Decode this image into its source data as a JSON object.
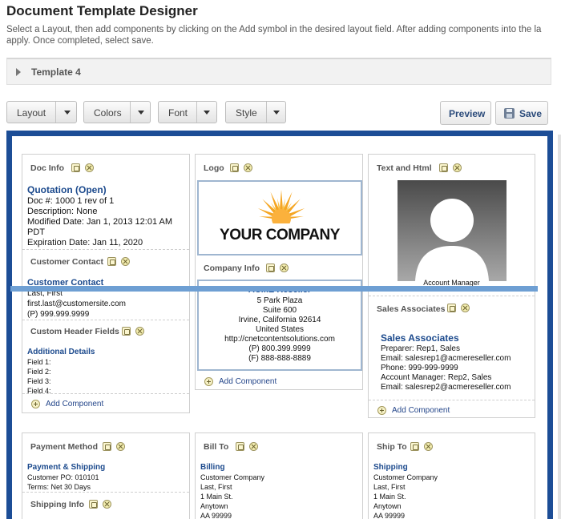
{
  "page": {
    "title": "Document Template Designer",
    "instructions": "Select a Layout, then add components by clicking on the Add symbol in the desired layout field. After adding components into the la apply. Once completed, select save."
  },
  "template": {
    "label": "Template 4",
    "icon": "triangle-right-icon"
  },
  "toolbar": {
    "layout": "Layout",
    "colors": "Colors",
    "font": "Font",
    "style": "Style",
    "preview": "Preview",
    "save": "Save"
  },
  "common": {
    "add_component": "Add Component"
  },
  "doc_info": {
    "header": "Doc Info",
    "title": "Quotation (Open)",
    "lines": [
      "Doc #: 1000   1 rev of 1",
      "Description: None",
      "Modified Date: Jan 1, 2013 12:01 AM",
      "PDT",
      "Expiration Date: Jan 11, 2020"
    ]
  },
  "customer_contact": {
    "header": "Customer Contact",
    "title": "Customer Contact",
    "lines": [
      "Last, First",
      "first.last@customersite.com",
      "(P) 999.999.9999"
    ]
  },
  "custom_header": {
    "header": "Custom Header Fields",
    "title": "Additional Details",
    "lines": [
      "Field 1:",
      "Field 2:",
      "Field 3:",
      "Field 4:"
    ]
  },
  "logo": {
    "header": "Logo",
    "text": "YOUR COMPANY",
    "sun_color": "#f5a623"
  },
  "company_info": {
    "header": "Company Info",
    "title": "ACME Reseller",
    "lines": [
      "5 Park Plaza",
      "Suite 600",
      "Irvine, California 92614",
      "United States",
      "http://cnetcontentsolutions.com",
      "(P) 800.399.9999",
      "(F) 888-888-8889"
    ]
  },
  "text_html": {
    "header": "Text and Html",
    "caption": "Account Manager"
  },
  "sales_associates": {
    "header": "Sales Associates",
    "title": "Sales Associates",
    "lines": [
      "Preparer: Rep1, Sales",
      "Email: salesrep1@acmereseller.com",
      "Phone: 999-999-9999",
      "Account Manager: Rep2, Sales",
      "Email: salesrep2@acmereseller.com"
    ]
  },
  "payment_method": {
    "header": "Payment Method",
    "title": "Payment & Shipping",
    "lines": [
      "Customer PO: 010101",
      "Terms: Net 30 Days"
    ]
  },
  "shipping_info": {
    "header": "Shipping Info"
  },
  "bill_to": {
    "header": "Bill To",
    "title": "Billing",
    "lines": [
      "Customer Company",
      "Last, First",
      "1 Main St.",
      "Anytown",
      "AA 99999"
    ]
  },
  "ship_to": {
    "header": "Ship To",
    "title": "Shipping",
    "lines": [
      "Customer Company",
      "Last, First",
      "1 Main St.",
      "Anytown",
      "AA 99999"
    ]
  },
  "colors": {
    "accent": "#1c4d96",
    "divider": "#6e9fd3",
    "link": "#1c4a8d"
  }
}
